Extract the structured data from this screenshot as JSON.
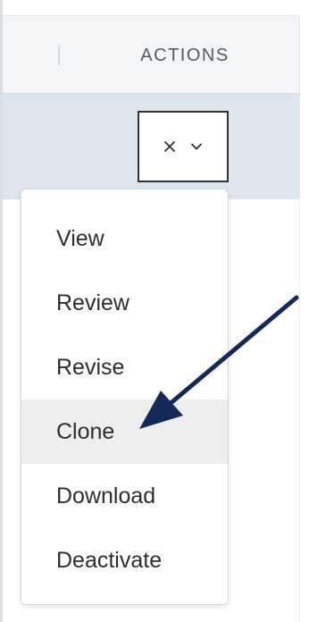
{
  "table": {
    "actions_header": "ACTIONS"
  },
  "action_button": {
    "icons": [
      "close-icon",
      "chevron-down-icon"
    ]
  },
  "menu": {
    "items": [
      {
        "label": "View"
      },
      {
        "label": "Review"
      },
      {
        "label": "Revise"
      },
      {
        "label": "Clone",
        "highlighted": true
      },
      {
        "label": "Download"
      },
      {
        "label": "Deactivate"
      }
    ]
  },
  "annotation": {
    "arrow_target": "Clone",
    "arrow_color": "#14295a"
  },
  "colors": {
    "header_bg": "#f3f5f7",
    "selected_row_bg": "#dde6ee",
    "highlight_bg": "#ededed",
    "text": "#2b2f33"
  }
}
